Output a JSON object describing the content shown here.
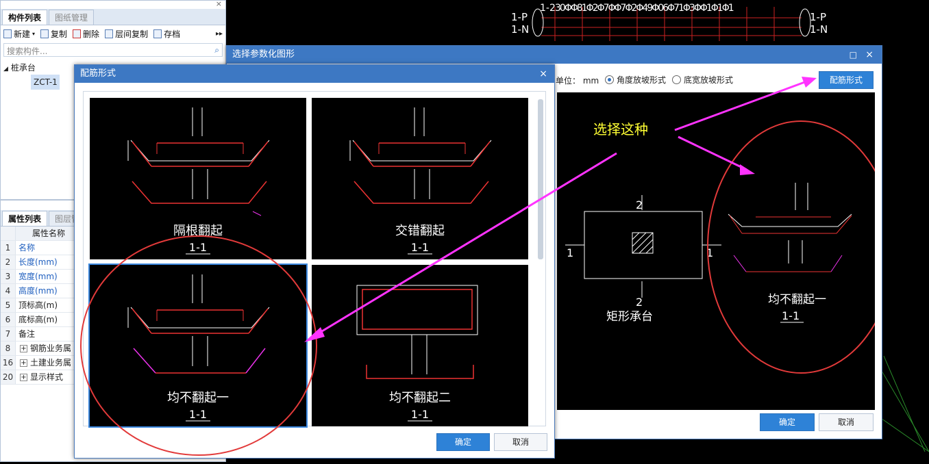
{
  "component_panel": {
    "tabs": [
      "构件列表",
      "图纸管理"
    ],
    "toolbar": {
      "new": "新建",
      "copy": "复制",
      "delete": "删除",
      "floor_copy": "层间复制",
      "save": "存档"
    },
    "search_placeholder": "搜索构件...",
    "tree_root": "桩承台",
    "tree_child": "ZCT-1"
  },
  "property_panel": {
    "tabs": [
      "属性列表",
      "图层管"
    ],
    "header": "属性名称",
    "rows": [
      {
        "num": "1",
        "name": "名称"
      },
      {
        "num": "2",
        "name": "长度(mm)"
      },
      {
        "num": "3",
        "name": "宽度(mm)"
      },
      {
        "num": "4",
        "name": "高度(mm)"
      },
      {
        "num": "5",
        "name": "顶标高(m)"
      },
      {
        "num": "6",
        "name": "底标高(m)"
      },
      {
        "num": "7",
        "name": "备注"
      },
      {
        "num": "8",
        "name": "钢筋业务属"
      },
      {
        "num": "16",
        "name": "土建业务属"
      },
      {
        "num": "20",
        "name": "显示样式"
      }
    ]
  },
  "param_dialog": {
    "title": "选择参数化图形",
    "unit_label": "单位： mm",
    "radio1": "角度放坡形式",
    "radio2": "底宽放坡形式",
    "rebar_button": "配筋形式",
    "ok": "确定",
    "cancel": "取消",
    "plan_title": "矩形承台",
    "section_title": "均不翻起一",
    "section_tag": "1-1",
    "callout": "选择这种",
    "dim_labels": {
      "a": "2",
      "b": "1"
    }
  },
  "rebar_dialog": {
    "title": "配筋形式",
    "ok": "确定",
    "cancel": "取消",
    "cards": [
      {
        "name": "隔根翻起",
        "tag": "1-1"
      },
      {
        "name": "交错翻起",
        "tag": "1-1"
      },
      {
        "name": "均不翻起一",
        "tag": "1-1"
      },
      {
        "name": "均不翻起二",
        "tag": "1-1"
      }
    ]
  },
  "cad_bg": {
    "labels": [
      "1-P",
      "1-N",
      "1-P",
      "1-N"
    ]
  },
  "colors": {
    "accent": "#3d78c3",
    "annotation": "#ff33ff",
    "circle": "#e23a3a",
    "callout": "#ffff33"
  }
}
